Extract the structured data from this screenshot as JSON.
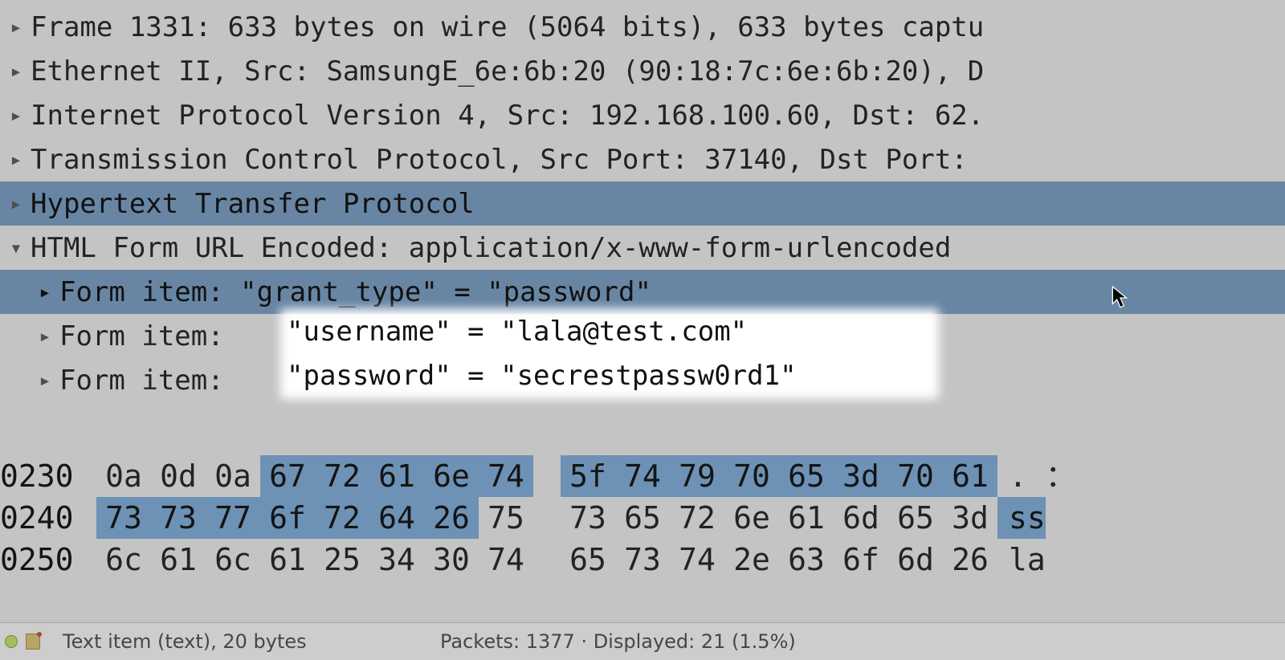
{
  "details": {
    "frame": "Frame 1331: 633 bytes on wire (5064 bits), 633 bytes captu",
    "ethernet": "Ethernet II, Src: SamsungE_6e:6b:20 (90:18:7c:6e:6b:20), D",
    "ip": "Internet Protocol Version 4, Src: 192.168.100.60, Dst: 62.",
    "tcp": "Transmission Control Protocol, Src Port: 37140, Dst Port:",
    "http": "Hypertext Transfer Protocol",
    "form_header": "HTML Form URL Encoded: application/x-www-form-urlencoded",
    "form_item_grant": "Form item: \"grant_type\" = \"password\"",
    "form_item_user_label": "Form item:",
    "form_item_user_value": "\"username\" = \"lala@test.com\"",
    "form_item_pass_label": "Form item:",
    "form_item_pass_value": "\"password\" = \"secrestpassw0rd1\""
  },
  "hex": {
    "rows": [
      {
        "offset": "0230",
        "bytes": [
          "0a",
          "0d",
          "0a",
          "67",
          "72",
          "61",
          "6e",
          "74",
          "5f",
          "74",
          "79",
          "70",
          "65",
          "3d",
          "70",
          "61"
        ],
        "ascii": ". ："
      },
      {
        "offset": "0240",
        "bytes": [
          "73",
          "73",
          "77",
          "6f",
          "72",
          "64",
          "26",
          "75",
          "73",
          "65",
          "72",
          "6e",
          "61",
          "6d",
          "65",
          "3d"
        ],
        "ascii": "ss"
      },
      {
        "offset": "0250",
        "bytes": [
          "6c",
          "61",
          "6c",
          "61",
          "25",
          "34",
          "30",
          "74",
          "65",
          "73",
          "74",
          "2e",
          "63",
          "6f",
          "6d",
          "26"
        ],
        "ascii": "la"
      }
    ]
  },
  "status": {
    "left": "Text item (text), 20 bytes",
    "mid": "Packets: 1377 · Displayed: 21 (1.5%)"
  }
}
